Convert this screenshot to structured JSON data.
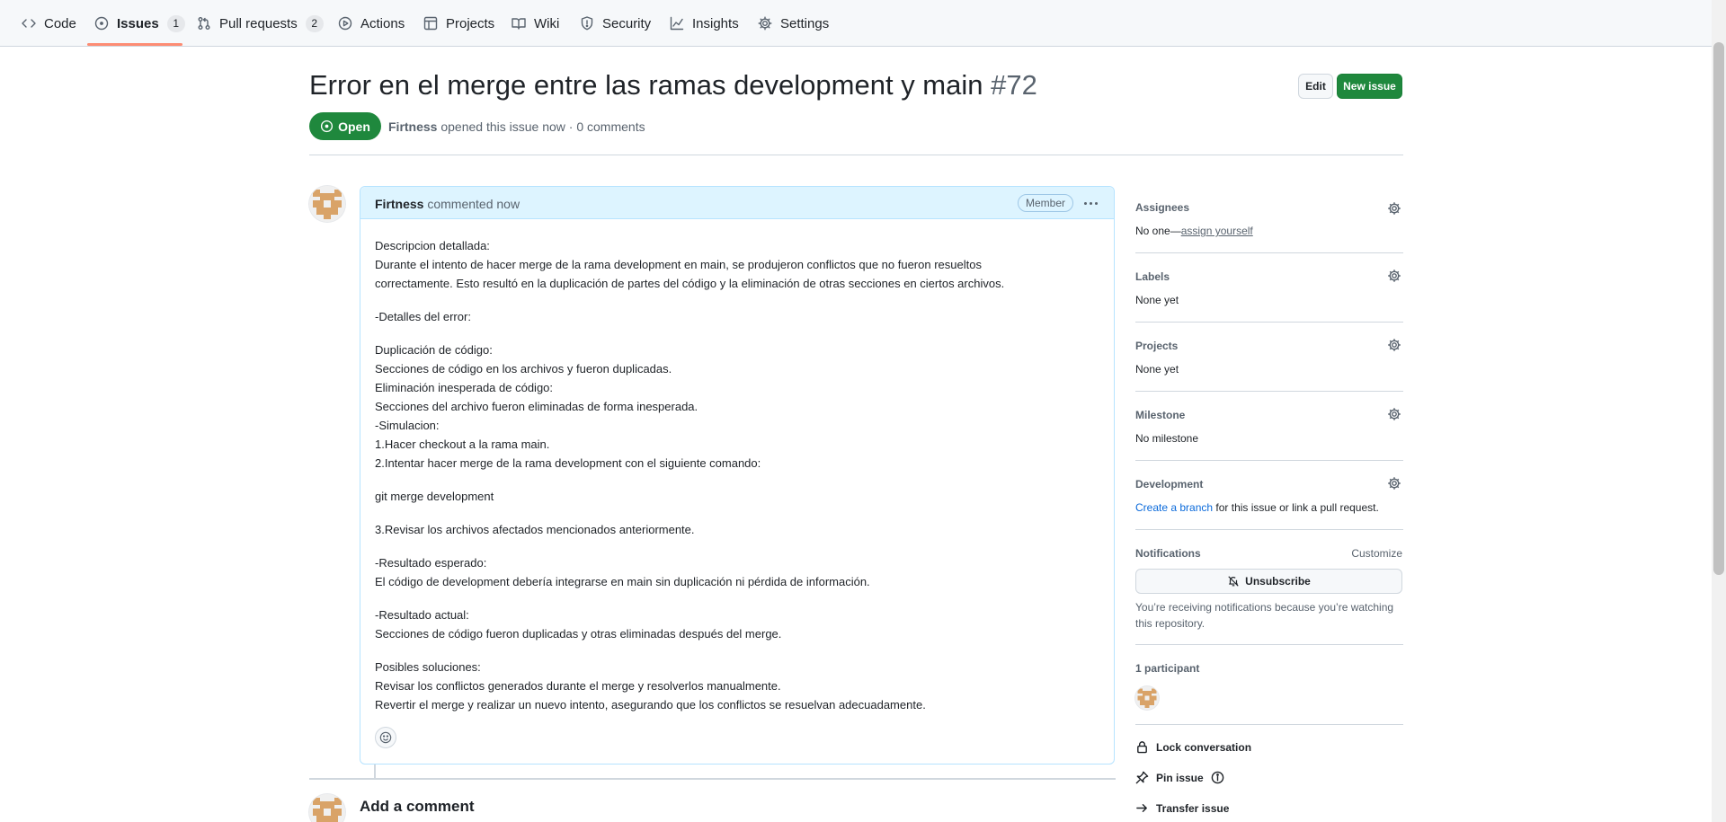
{
  "nav": {
    "tabs": [
      {
        "label": "Code",
        "icon": "code-icon"
      },
      {
        "label": "Issues",
        "icon": "issue-opened-icon",
        "count": "1",
        "selected": true
      },
      {
        "label": "Pull requests",
        "icon": "git-pull-request-icon",
        "count": "2"
      },
      {
        "label": "Actions",
        "icon": "play-icon"
      },
      {
        "label": "Projects",
        "icon": "table-icon"
      },
      {
        "label": "Wiki",
        "icon": "book-icon"
      },
      {
        "label": "Security",
        "icon": "shield-icon"
      },
      {
        "label": "Insights",
        "icon": "graph-icon"
      },
      {
        "label": "Settings",
        "icon": "gear-icon"
      }
    ]
  },
  "issue": {
    "title": "Error en el merge entre las ramas development y main",
    "number": "#72",
    "state": "Open",
    "author": "Firtness",
    "meta_text": "opened this issue now · 0 comments",
    "edit_label": "Edit",
    "new_issue_label": "New issue"
  },
  "comment": {
    "author": "Firtness",
    "time_text": "commented now",
    "role_badge": "Member",
    "body_lines": [
      "Descripcion detallada:",
      "Durante el intento de hacer merge de la rama development en main, se produjeron conflictos que no fueron resueltos",
      "correctamente. Esto resultó en la duplicación de partes del código y la eliminación de otras secciones en ciertos archivos.",
      "",
      "-Detalles del error:",
      "",
      "Duplicación de código:",
      "Secciones de código en los archivos y fueron duplicadas.",
      "Eliminación inesperada de código:",
      "Secciones del archivo fueron eliminadas de forma inesperada.",
      "-Simulacion:",
      "1.Hacer checkout a la rama main.",
      "2.Intentar hacer merge de la rama development con el siguiente comando:",
      "",
      "git merge development",
      "",
      "3.Revisar los archivos afectados mencionados anteriormente.",
      "",
      "-Resultado esperado:",
      "El código de development debería integrarse en main sin duplicación ni pérdida de información.",
      "",
      "-Resultado actual:",
      "Secciones de código fueron duplicadas y otras eliminadas después del merge.",
      "",
      "Posibles soluciones:",
      "Revisar los conflictos generados durante el merge y resolverlos manualmente.",
      "Revertir el merge y realizar un nuevo intento, asegurando que los conflictos se resuelvan adecuadamente."
    ]
  },
  "add_comment": {
    "heading": "Add a comment"
  },
  "sidebar": {
    "assignees": {
      "heading": "Assignees",
      "value_prefix": "No one—",
      "value_link": "assign yourself"
    },
    "labels": {
      "heading": "Labels",
      "value": "None yet"
    },
    "projects": {
      "heading": "Projects",
      "value": "None yet"
    },
    "milestone": {
      "heading": "Milestone",
      "value": "No milestone"
    },
    "development": {
      "heading": "Development",
      "link": "Create a branch",
      "text": " for this issue or link a pull request."
    },
    "notifications": {
      "heading": "Notifications",
      "customize": "Customize",
      "button": "Unsubscribe",
      "reason_line1": "You’re receiving notifications because you’re watching",
      "reason_line2": "this repository."
    },
    "participants": {
      "heading": "1 participant"
    },
    "actions": {
      "lock": "Lock conversation",
      "pin": "Pin issue",
      "transfer": "Transfer issue"
    }
  },
  "colors": {
    "accent_green": "#1f883d",
    "link_blue": "#0969da",
    "tab_underline": "#fd8c73"
  }
}
